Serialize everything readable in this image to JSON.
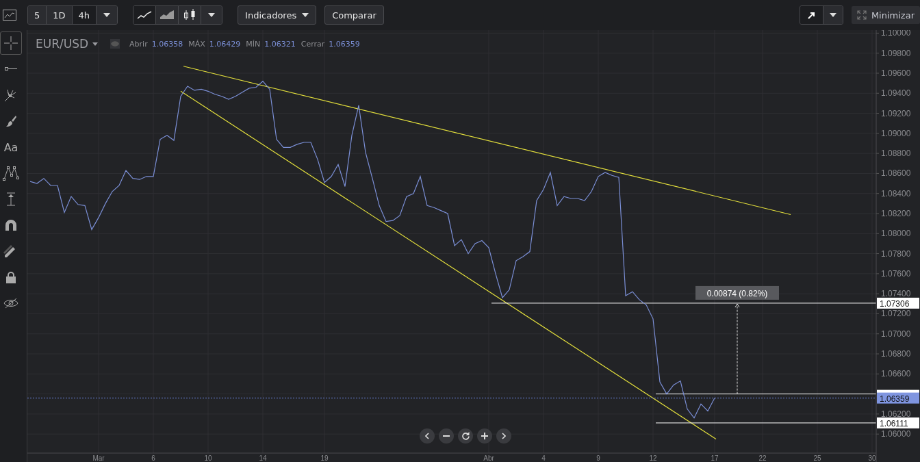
{
  "toolbar": {
    "intervals": [
      {
        "label": "5",
        "selected": false
      },
      {
        "label": "1D",
        "selected": false
      },
      {
        "label": "4h",
        "selected": true
      }
    ],
    "chart_styles": [
      {
        "kind": "line",
        "selected": true
      },
      {
        "kind": "area",
        "selected": false
      },
      {
        "kind": "candles",
        "selected": false
      }
    ],
    "indicators_button": "Indicadores",
    "compare_button": "Comparar",
    "minimize_button": "Minimizar"
  },
  "sidebar": {
    "tools": [
      {
        "kind": "crosshair",
        "selected": true
      },
      {
        "kind": "horizontal-line",
        "selected": false
      },
      {
        "kind": "pitchfork",
        "selected": false
      },
      {
        "kind": "brush",
        "selected": false
      },
      {
        "kind": "text",
        "label": "Aa",
        "selected": false
      },
      {
        "kind": "pattern",
        "selected": false
      },
      {
        "kind": "measure",
        "selected": false
      },
      {
        "kind": "magnet",
        "selected": false
      },
      {
        "kind": "pencils",
        "selected": false
      },
      {
        "kind": "lock",
        "selected": false
      },
      {
        "kind": "eye-off",
        "selected": false
      }
    ]
  },
  "legend": {
    "fields": [
      {
        "label": "Abrir",
        "value": "1.06358"
      },
      {
        "label": "MÁX",
        "value": "1.06429"
      },
      {
        "label": "MÍN",
        "value": "1.06321"
      },
      {
        "label": "Cerrar",
        "value": "1.06359"
      }
    ]
  },
  "chart": {
    "chart_data": {
      "type": "line",
      "grid": true,
      "series": [
        {
          "name": "EUR/USD",
          "color": "#7b8fd6",
          "values": [
            1.0852,
            1.085,
            1.0855,
            1.0848,
            1.0848,
            1.0821,
            1.0837,
            1.0829,
            1.0828,
            1.0804,
            1.0816,
            1.083,
            1.0842,
            1.0848,
            1.0863,
            1.0855,
            1.0854,
            1.0857,
            1.0857,
            1.0894,
            1.0898,
            1.0893,
            1.0937,
            1.0947,
            1.0943,
            1.0944,
            1.0942,
            1.0939,
            1.0937,
            1.0934,
            1.0937,
            1.0941,
            1.0945,
            1.0946,
            1.0952,
            1.0944,
            1.0894,
            1.0886,
            1.0886,
            1.0889,
            1.0891,
            1.0891,
            1.0874,
            1.0851,
            1.0857,
            1.0869,
            1.0847,
            1.0898,
            1.0928,
            1.0881,
            1.0855,
            1.0828,
            1.0812,
            1.0813,
            1.0818,
            1.0837,
            1.084,
            1.0857,
            1.0828,
            1.0826,
            1.0823,
            1.082,
            1.0788,
            1.0794,
            1.078,
            1.079,
            1.0793,
            1.0786,
            1.076,
            1.0736,
            1.0744,
            1.0773,
            1.0777,
            1.0782,
            1.0833,
            1.0844,
            1.0861,
            1.0828,
            1.0837,
            1.0835,
            1.0835,
            1.0833,
            1.0842,
            1.0857,
            1.0861,
            1.0858,
            1.0856,
            1.0738,
            1.0742,
            1.0734,
            1.0729,
            1.0715,
            1.0652,
            1.064,
            1.0649,
            1.0653,
            1.0625,
            1.0616,
            1.063,
            1.0623,
            1.0636,
            null,
            null,
            null,
            null,
            null,
            null,
            null,
            null,
            null,
            null,
            null,
            null,
            null,
            null,
            null,
            null,
            null,
            null,
            null,
            null,
            null,
            null,
            null
          ]
        }
      ],
      "categories": [
        null,
        null,
        null,
        null,
        null,
        null,
        null,
        null,
        null,
        null,
        "Mar",
        null,
        null,
        null,
        null,
        null,
        null,
        null,
        "6",
        null,
        null,
        null,
        null,
        null,
        null,
        null,
        "10",
        null,
        null,
        null,
        null,
        null,
        null,
        null,
        "14",
        null,
        null,
        null,
        null,
        null,
        null,
        null,
        null,
        "19",
        null,
        null,
        null,
        null,
        null,
        null,
        null,
        null,
        null,
        null,
        null,
        null,
        null,
        null,
        null,
        null,
        null,
        null,
        null,
        null,
        null,
        null,
        null,
        "Abr",
        null,
        null,
        null,
        null,
        null,
        null,
        null,
        "4",
        null,
        null,
        null,
        null,
        null,
        null,
        null,
        "9",
        null,
        null,
        null,
        null,
        null,
        null,
        null,
        "12",
        null,
        null,
        null,
        null,
        null,
        null,
        null,
        null,
        "17",
        null,
        null,
        null,
        null,
        null,
        null,
        "22",
        null,
        null,
        null,
        null,
        null,
        null,
        null,
        "25",
        null,
        null,
        null,
        null,
        null,
        null,
        null,
        "30"
      ],
      "ylim": [
        1.0581,
        1.1003
      ],
      "yticks": [
        {
          "value": 1.06,
          "label": "1.06000"
        },
        {
          "value": 1.062,
          "label": "1.06200"
        },
        {
          "value": 1.066,
          "label": "1.06600"
        },
        {
          "value": 1.068,
          "label": "1.06800"
        },
        {
          "value": 1.07,
          "label": "1.07000"
        },
        {
          "value": 1.072,
          "label": "1.07200"
        },
        {
          "value": 1.074,
          "label": "1.07400"
        },
        {
          "value": 1.076,
          "label": "1.07600"
        },
        {
          "value": 1.078,
          "label": "1.07800"
        },
        {
          "value": 1.08,
          "label": "1.08000"
        },
        {
          "value": 1.082,
          "label": "1.08200"
        },
        {
          "value": 1.084,
          "label": "1.08400"
        },
        {
          "value": 1.086,
          "label": "1.08600"
        },
        {
          "value": 1.088,
          "label": "1.08800"
        },
        {
          "value": 1.09,
          "label": "1.09000"
        },
        {
          "value": 1.092,
          "label": "1.09200"
        },
        {
          "value": 1.094,
          "label": "1.09400"
        },
        {
          "value": 1.096,
          "label": "1.09600"
        },
        {
          "value": 1.098,
          "label": "1.09800"
        },
        {
          "value": 1.1,
          "label": "1.10000"
        }
      ]
    },
    "drawings": [
      {
        "kind": "trendline"
      },
      {
        "kind": "trendline"
      },
      {
        "kind": "hline",
        "label": "1.07306"
      },
      {
        "kind": "hline"
      },
      {
        "kind": "last",
        "label": "1.06359"
      },
      {
        "kind": "hline",
        "label": "1.06111"
      },
      {
        "kind": "measure",
        "label": "0.00874 (0.82%)"
      }
    ]
  },
  "zoom_controls": [
    {
      "kind": "prev"
    },
    {
      "kind": "zoom-out"
    },
    {
      "kind": "reset"
    },
    {
      "kind": "zoom-in"
    },
    {
      "kind": "next"
    }
  ]
}
